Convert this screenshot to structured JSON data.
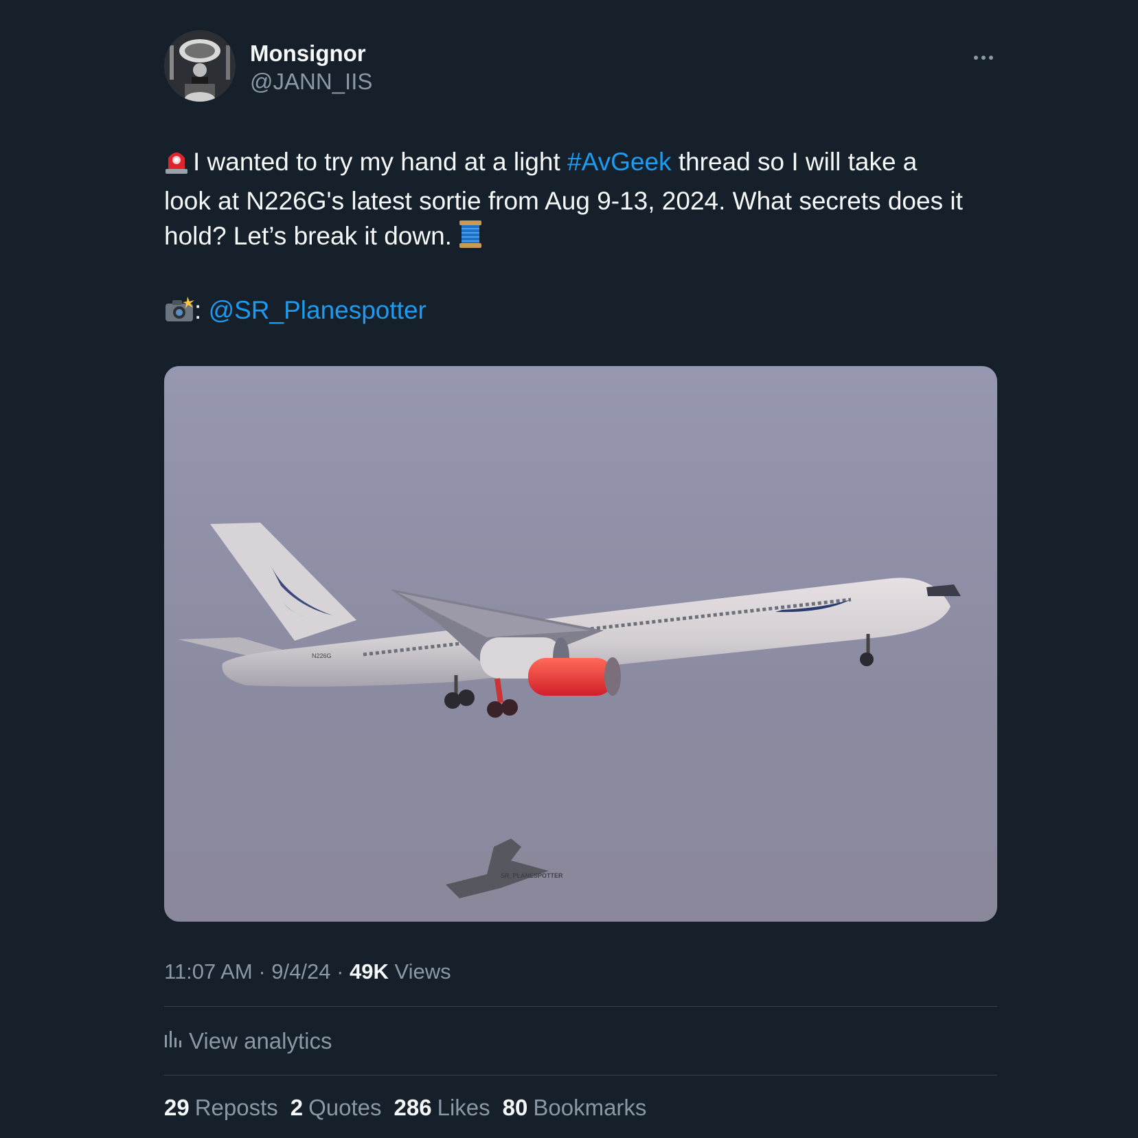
{
  "author": {
    "display_name": "Monsignor",
    "handle": "@JANN_IIS"
  },
  "tweet": {
    "line1_prefix": "I wanted to try my hand at a light ",
    "hashtag": "#AvGeek",
    "line1_suffix": " thread so I will take a",
    "line2": "look at N226G's latest sortie from Aug 9-13, 2024. What secrets does it",
    "line3": "hold? Let’s break it down.",
    "credit_sep": ":",
    "mention": "@SR_Planespotter"
  },
  "media": {
    "registration": "N226G",
    "watermark": "SR_PLANESPOTTER"
  },
  "meta": {
    "time": "11:07 AM",
    "date": "9/4/24",
    "views_count": "49K",
    "views_label": "Views",
    "sep": "·"
  },
  "analytics": {
    "label": "View analytics"
  },
  "stats": {
    "reposts_count": "29",
    "reposts_label": "Reposts",
    "quotes_count": "2",
    "quotes_label": "Quotes",
    "likes_count": "286",
    "likes_label": "Likes",
    "bookmarks_count": "80",
    "bookmarks_label": "Bookmarks"
  },
  "icons": {
    "siren": "siren-emoji-icon",
    "spool": "thread-spool-emoji-icon",
    "camera": "camera-flash-emoji-icon",
    "more": "more-horizontal-icon",
    "analytics": "bar-chart-icon"
  },
  "colors": {
    "background": "#15202b",
    "text": "#f7f9f9",
    "secondary": "#8b98a5",
    "link": "#1d9bf0",
    "divider": "#38444d"
  }
}
